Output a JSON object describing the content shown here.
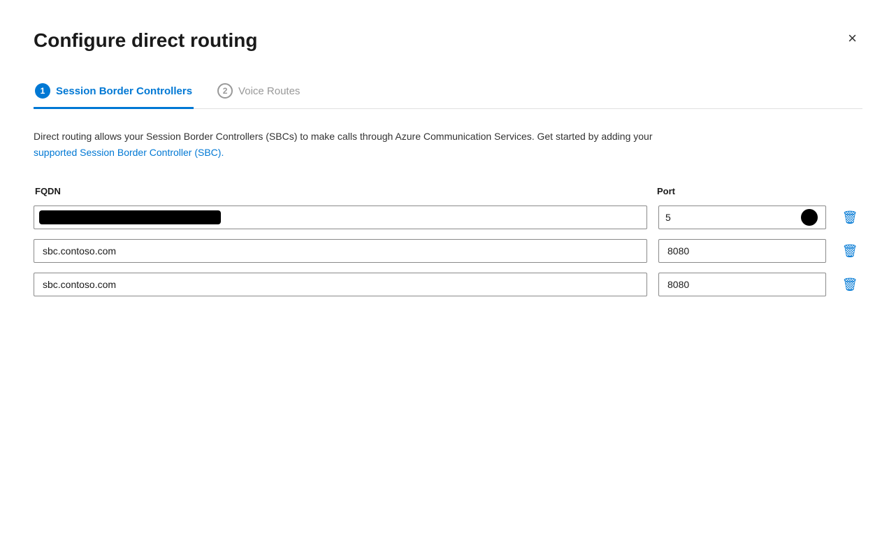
{
  "dialog": {
    "title": "Configure direct routing",
    "close_label": "×"
  },
  "tabs": [
    {
      "id": "sbc",
      "number": "1",
      "label": "Session Border Controllers",
      "active": true
    },
    {
      "id": "voice-routes",
      "number": "2",
      "label": "Voice Routes",
      "active": false
    }
  ],
  "description": {
    "text_before_link": "Direct routing allows your Session Border Controllers (SBCs) to make calls through Azure Communication Services. Get started by adding your ",
    "link_text": "supported Session Border Controller (SBC).",
    "text_after_link": ""
  },
  "table": {
    "columns": {
      "fqdn": "FQDN",
      "port": "Port"
    },
    "rows": [
      {
        "fqdn": "",
        "fqdn_redacted": true,
        "port": "5"
      },
      {
        "fqdn": "sbc.contoso.com",
        "fqdn_redacted": false,
        "port": "8080"
      },
      {
        "fqdn": "sbc.contoso.com",
        "fqdn_redacted": false,
        "port": "8080"
      }
    ]
  },
  "colors": {
    "accent": "#0078d4",
    "active_tab": "#0078d4"
  }
}
